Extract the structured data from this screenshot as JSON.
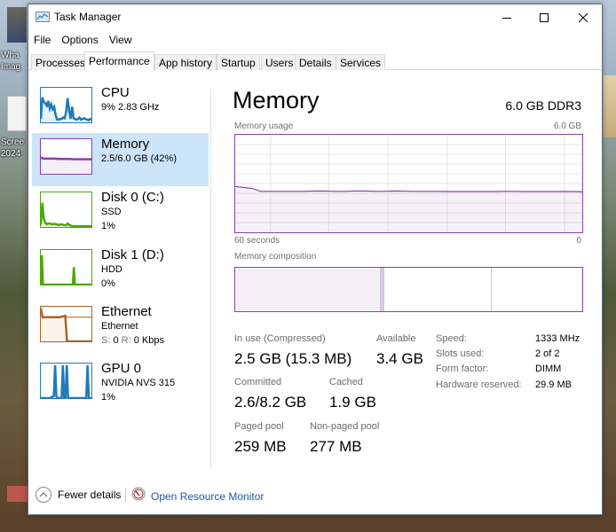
{
  "desktop": {
    "icons": [
      {
        "label_line1": "Wha",
        "label_line2": "Imag"
      },
      {
        "label_line1": "Scree",
        "label_line2": "2024-"
      }
    ]
  },
  "window": {
    "title": "Task Manager",
    "controls": {
      "minimize": "minimize",
      "maximize": "maximize",
      "close": "close"
    }
  },
  "menu": [
    "File",
    "Options",
    "View"
  ],
  "tabs": [
    {
      "label": "Processes",
      "active": false
    },
    {
      "label": "Performance",
      "active": true
    },
    {
      "label": "App history",
      "active": false
    },
    {
      "label": "Startup",
      "active": false
    },
    {
      "label": "Users",
      "active": false
    },
    {
      "label": "Details",
      "active": false
    },
    {
      "label": "Services",
      "active": false
    }
  ],
  "sidebar": {
    "items": [
      {
        "title": "CPU",
        "line1": "9% 2.83 GHz",
        "line2": "",
        "color": "#1e7ab8",
        "active": false
      },
      {
        "title": "Memory",
        "line1": "2.5/6.0 GB (42%)",
        "line2": "",
        "color": "#8b3fa5",
        "active": true
      },
      {
        "title": "Disk 0 (C:)",
        "line1": "SSD",
        "line2": "1%",
        "color": "#4da60c",
        "active": false
      },
      {
        "title": "Disk 1 (D:)",
        "line1": "HDD",
        "line2": "0%",
        "color": "#4da60c",
        "active": false
      },
      {
        "title": "Ethernet",
        "line1": "Ethernet",
        "line2": {
          "send_label": "S:",
          "send_value": "0",
          "recv_label": "R:",
          "recv_value": "0 Kbps"
        },
        "color": "#a7652b",
        "active": false
      },
      {
        "title": "GPU 0",
        "line1": "NVIDIA NVS 315",
        "line2": "1%",
        "color": "#1e7ab8",
        "active": false
      }
    ],
    "sparklines": {
      "cpu": [
        10,
        72,
        60,
        55,
        48,
        62,
        40,
        52,
        38,
        45,
        20,
        8,
        8,
        10,
        10,
        14,
        12,
        30,
        70,
        35,
        10,
        45,
        12,
        10,
        8,
        10,
        14,
        8,
        10,
        12,
        10,
        8,
        6,
        10,
        8
      ],
      "memory": [
        48,
        44,
        44,
        44,
        44,
        44,
        44,
        44,
        43,
        43,
        43,
        43,
        43,
        43,
        43,
        42,
        42,
        42,
        42,
        42,
        42,
        42,
        42,
        42,
        42
      ],
      "disk0": [
        5,
        70,
        25,
        12,
        8,
        10,
        10,
        8,
        8,
        9,
        8,
        7,
        6,
        7,
        8,
        6,
        5,
        5,
        10,
        6,
        4,
        3,
        2,
        2,
        2,
        2,
        2,
        2,
        2,
        2,
        2,
        2,
        2,
        2,
        2
      ],
      "disk1": [
        0,
        85,
        0,
        0,
        0,
        0,
        0,
        0,
        0,
        0,
        0,
        0,
        0,
        0,
        0,
        0,
        0,
        0,
        0,
        0,
        0,
        0,
        0,
        0,
        0,
        0,
        0,
        0,
        0,
        0,
        0,
        0,
        50,
        0,
        0,
        0,
        0,
        0,
        0,
        0,
        0,
        0,
        0,
        0,
        0,
        0,
        0,
        0,
        0,
        0
      ],
      "ethernet": [
        96,
        70,
        70,
        70,
        70,
        70,
        70,
        70,
        70,
        70,
        70,
        70,
        72,
        72,
        74,
        0,
        0,
        0,
        0,
        0,
        0,
        0,
        0,
        0,
        0,
        0,
        0,
        0,
        0,
        0
      ],
      "gpu": [
        0,
        0,
        0,
        0,
        0,
        0,
        0,
        0,
        2,
        4,
        5,
        95,
        5,
        0,
        0,
        0,
        0,
        95,
        0,
        0,
        95,
        0,
        0,
        0,
        0,
        0,
        0,
        0,
        0,
        0,
        0,
        0,
        0,
        0,
        0,
        0,
        95,
        0,
        0,
        0
      ]
    }
  },
  "main": {
    "title": "Memory",
    "spec": "6.0 GB DDR3",
    "usage_graph": {
      "label": "Memory usage",
      "max_label": "6.0 GB",
      "x_left_label": "60 seconds",
      "x_right_label": "0",
      "max_gb": 6.0,
      "usage_percent_series": [
        47,
        46,
        45,
        42,
        42,
        42,
        42,
        42,
        42,
        42.2,
        42.4,
        42.2,
        42,
        42,
        42.3,
        42.4,
        42.2,
        42,
        42.2,
        42.4,
        42.2,
        42,
        42,
        42,
        42,
        41.8,
        41.8,
        41.8,
        41.8,
        41.8,
        41.8,
        41.8,
        42,
        42,
        41.8,
        41.8,
        41.8,
        41.8,
        41.8,
        41.8,
        41.8,
        41.6
      ]
    },
    "composition": {
      "label": "Memory composition",
      "segments": [
        {
          "name": "in-use",
          "fraction": 0.42,
          "color": "#f4eff6"
        },
        {
          "name": "modified",
          "fraction": 0.01,
          "color": "#dcc5e3"
        },
        {
          "name": "standby",
          "fraction": 0.31,
          "color": "#ffffff"
        },
        {
          "name": "free",
          "fraction": 0.26,
          "color": "#ffffff"
        }
      ]
    },
    "stats": {
      "in_use": {
        "label": "In use (Compressed)",
        "value": "2.5 GB (15.3 MB)"
      },
      "available": {
        "label": "Available",
        "value": "3.4 GB"
      },
      "committed": {
        "label": "Committed",
        "value": "2.6/8.2 GB"
      },
      "cached": {
        "label": "Cached",
        "value": "1.9 GB"
      },
      "paged_pool": {
        "label": "Paged pool",
        "value": "259 MB"
      },
      "non_paged_pool": {
        "label": "Non-paged pool",
        "value": "277 MB"
      }
    },
    "specs": [
      {
        "label": "Speed:",
        "value": "1333 MHz"
      },
      {
        "label": "Slots used:",
        "value": "2 of 2"
      },
      {
        "label": "Form factor:",
        "value": "DIMM"
      },
      {
        "label": "Hardware reserved:",
        "value": "29.9 MB"
      }
    ]
  },
  "footer": {
    "fewer_details": "Fewer details",
    "open_resource_monitor": "Open Resource Monitor"
  }
}
